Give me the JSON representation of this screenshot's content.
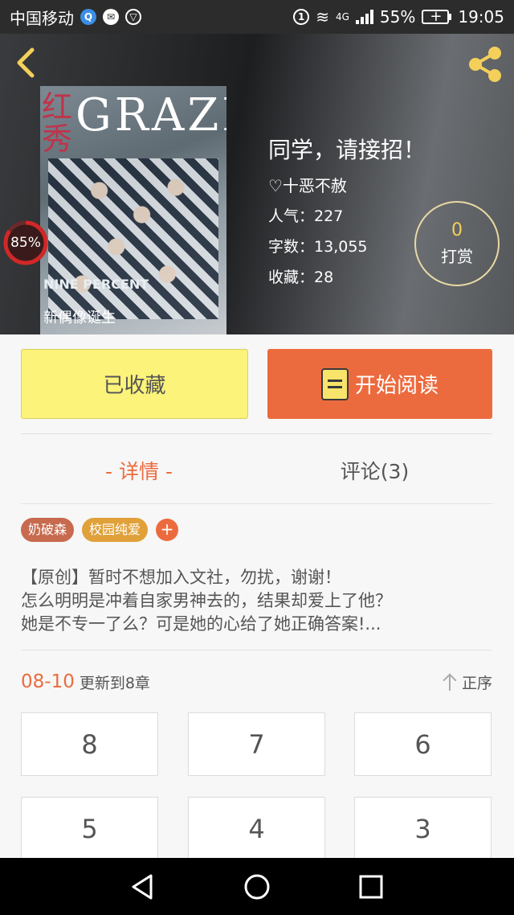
{
  "status_bar": {
    "carrier": "中国移动",
    "network": "4G",
    "battery": "55%",
    "time": "19:05"
  },
  "book": {
    "title": "同学，请接招！",
    "author": "♡十恶不赦",
    "popularity_label": "人气：",
    "popularity": "227",
    "word_count_label": "字数：",
    "word_count": "13,055",
    "favorites_label": "收藏：",
    "favorites": "28",
    "read_progress": "85%",
    "read_progress_fraction": 0.85,
    "cover": {
      "magazine": "GRAZIA",
      "red_title": "红秀",
      "nine_percent": "NINE PERCENT",
      "subtitle": "新偶像诞生"
    }
  },
  "tip": {
    "count": "0",
    "label": "打赏"
  },
  "actions": {
    "collected_label": "已收藏",
    "start_reading_label": "开始阅读"
  },
  "tabs": [
    {
      "label": "- 详情 -",
      "active": true
    },
    {
      "label": "评论(3)",
      "active": false
    }
  ],
  "tags": [
    "奶破森",
    "校园纯爱"
  ],
  "tag_add": "+",
  "description": [
    "【原创】暂时不想加入文社，勿扰，谢谢！",
    "怎么明明是冲着自家男神去的，结果却爱上了他？",
    "她是不专一了么？可是她的心给了她正确答案!..."
  ],
  "update": {
    "date": "08-10",
    "text": "更新到8章",
    "sort_label": "正序"
  },
  "chapters": [
    "8",
    "7",
    "6",
    "5",
    "4",
    "3"
  ],
  "colors": {
    "accent": "#ec6b3e",
    "collect_button": "#fbf37a",
    "tip_count": "#f4d05a"
  }
}
